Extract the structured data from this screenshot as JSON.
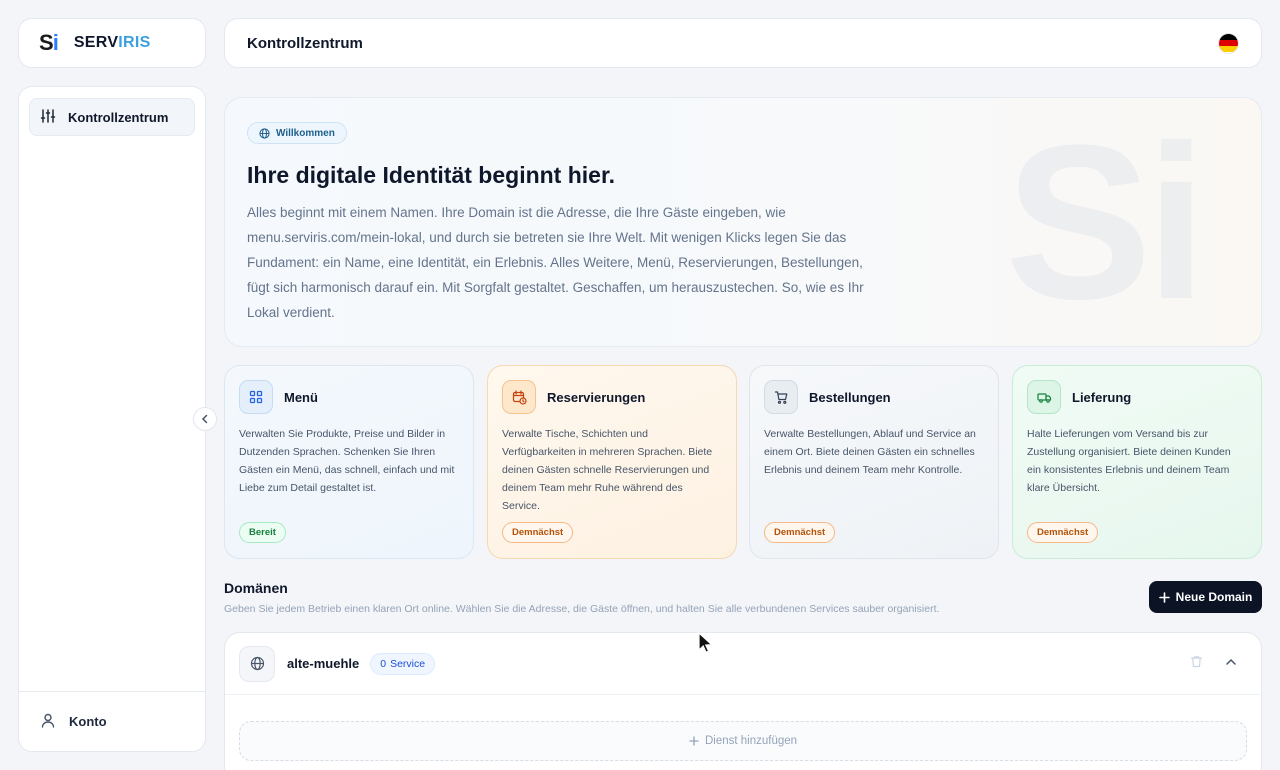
{
  "brand": {
    "mark_s": "S",
    "mark_i": "i",
    "name_a": "SERV",
    "name_b": "IRIS"
  },
  "header": {
    "title": "Kontrollzentrum",
    "flag": {
      "colors": [
        "#000000",
        "#dd0000",
        "#ffce00"
      ]
    }
  },
  "sidebar": {
    "items": [
      {
        "label": "Kontrollzentrum",
        "icon": "sliders-icon",
        "active": true
      }
    ],
    "bottom": {
      "label": "Konto",
      "icon": "user-icon"
    }
  },
  "hero": {
    "pill": "Willkommen",
    "watermark": "Si",
    "title": "Ihre digitale Identität beginnt hier.",
    "text": "Alles beginnt mit einem Namen. Ihre Domain ist die Adresse, die Ihre Gäste eingeben, wie menu.serviris.com/mein-lokal, und durch sie betreten sie Ihre Welt. Mit wenigen Klicks legen Sie das Fundament: ein Name, eine Identität, ein Erlebnis. Alles Weitere, Menü, Reservierungen, Bestellungen, fügt sich harmonisch darauf ein. Mit Sorgfalt gestaltet. Geschaffen, um herauszustechen. So, wie es Ihr Lokal verdient."
  },
  "features": [
    {
      "title": "Menü",
      "icon": "grid-icon",
      "text": "Verwalten Sie Produkte, Preise und Bilder in Dutzenden Sprachen. Schenken Sie Ihren Gästen ein Menü, das schnell, einfach und mit Liebe zum Detail gestaltet ist.",
      "badge": "Bereit"
    },
    {
      "title": "Reservierungen",
      "icon": "calendar-clock-icon",
      "text": "Verwalte Tische, Schichten und Verfügbarkeiten in mehreren Sprachen. Biete deinen Gästen schnelle Reservierungen und deinem Team mehr Ruhe während des Service.",
      "badge": "Demnächst"
    },
    {
      "title": "Bestellungen",
      "icon": "cart-icon",
      "text": "Verwalte Bestellungen, Ablauf und Service an einem Ort. Biete deinen Gästen ein schnelles Erlebnis und deinem Team mehr Kontrolle.",
      "badge": "Demnächst"
    },
    {
      "title": "Lieferung",
      "icon": "truck-icon",
      "text": "Halte Lieferungen vom Versand bis zur Zustellung organisiert. Biete deinen Kunden ein konsistentes Erlebnis und deinem Team klare Übersicht.",
      "badge": "Demnächst"
    }
  ],
  "domains": {
    "title": "Domänen",
    "subtitle": "Geben Sie jedem Betrieb einen klaren Ort online. Wählen Sie die Adresse, die Gäste öffnen, und halten Sie alle verbundenen Services sauber organisiert.",
    "new_button": "Neue Domain",
    "items": [
      {
        "name": "alte-muehle",
        "service_count": "0",
        "service_label": "Service"
      }
    ],
    "add_service": "Dienst hinzufügen"
  }
}
